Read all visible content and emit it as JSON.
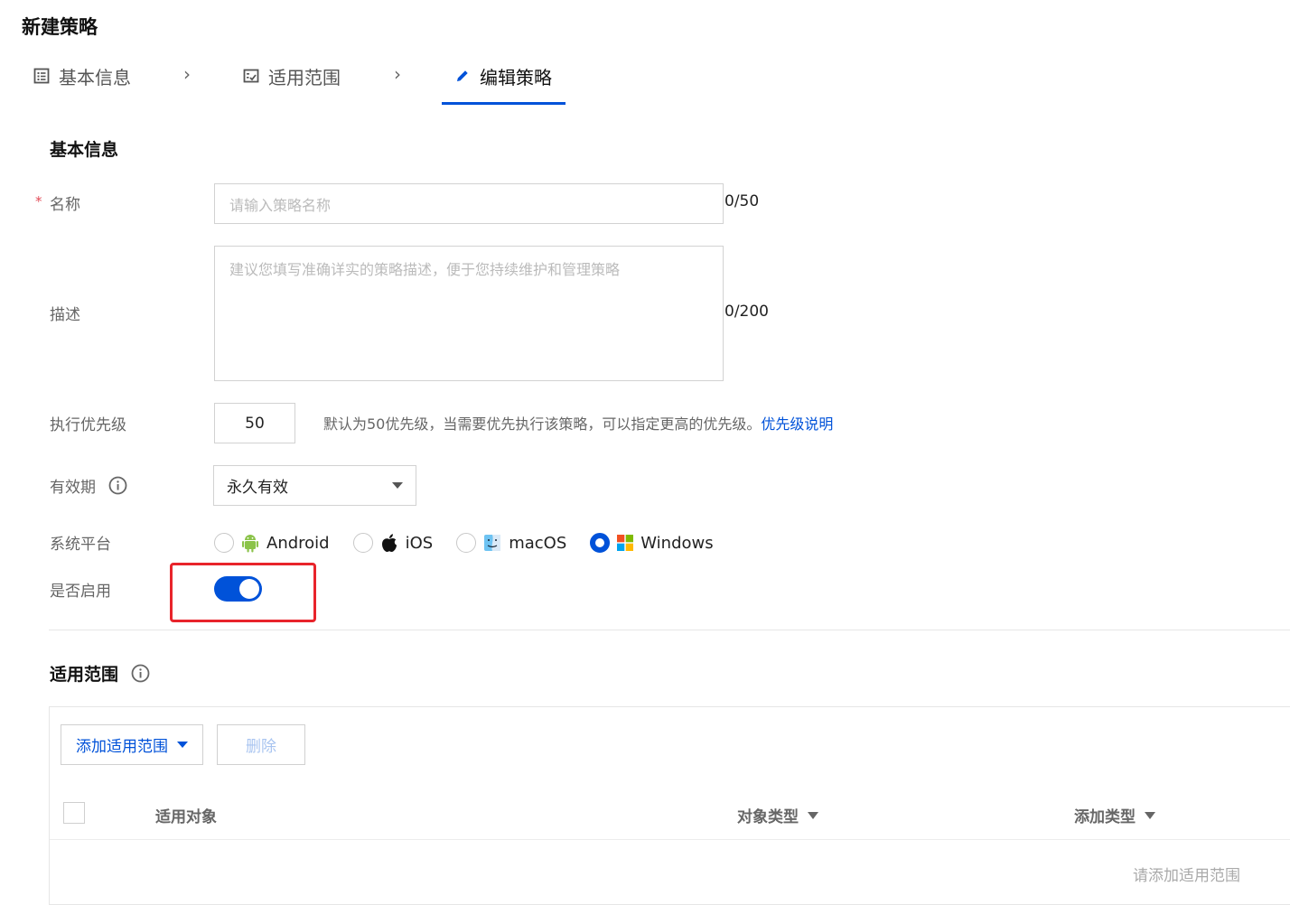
{
  "page": {
    "title": "新建策略"
  },
  "steps": [
    {
      "label": "基本信息",
      "icon": "form-icon"
    },
    {
      "label": "适用范围",
      "icon": "scope-icon"
    },
    {
      "label": "编辑策略",
      "icon": "pencil-icon",
      "active": true
    }
  ],
  "basic": {
    "title": "基本信息",
    "name": {
      "required_mark": "*",
      "label": "名称",
      "placeholder": "请输入策略名称",
      "counter": "0/50"
    },
    "description": {
      "label": "描述",
      "placeholder": "建议您填写准确详实的策略描述，便于您持续维护和管理策略",
      "counter": "0/200"
    },
    "priority": {
      "label": "执行优先级",
      "value": "50",
      "hint": "默认为50优先级，当需要优先执行该策略，可以指定更高的优先级。",
      "link": "优先级说明"
    },
    "validity": {
      "label": "有效期",
      "selected": "永久有效"
    },
    "platform": {
      "label": "系统平台",
      "options": [
        {
          "label": "Android",
          "selected": false
        },
        {
          "label": "iOS",
          "selected": false
        },
        {
          "label": "macOS",
          "selected": false
        },
        {
          "label": "Windows",
          "selected": true
        }
      ]
    },
    "enabled": {
      "label": "是否启用",
      "value": true
    }
  },
  "scope": {
    "title": "适用范围",
    "add_button": "添加适用范围",
    "delete_button": "删除",
    "columns": [
      "适用对象",
      "对象类型",
      "添加类型"
    ],
    "empty_text": "请添加适用范围"
  },
  "colors": {
    "accent": "#0052d9",
    "highlight": "#e8242b",
    "required": "#e34d59"
  }
}
